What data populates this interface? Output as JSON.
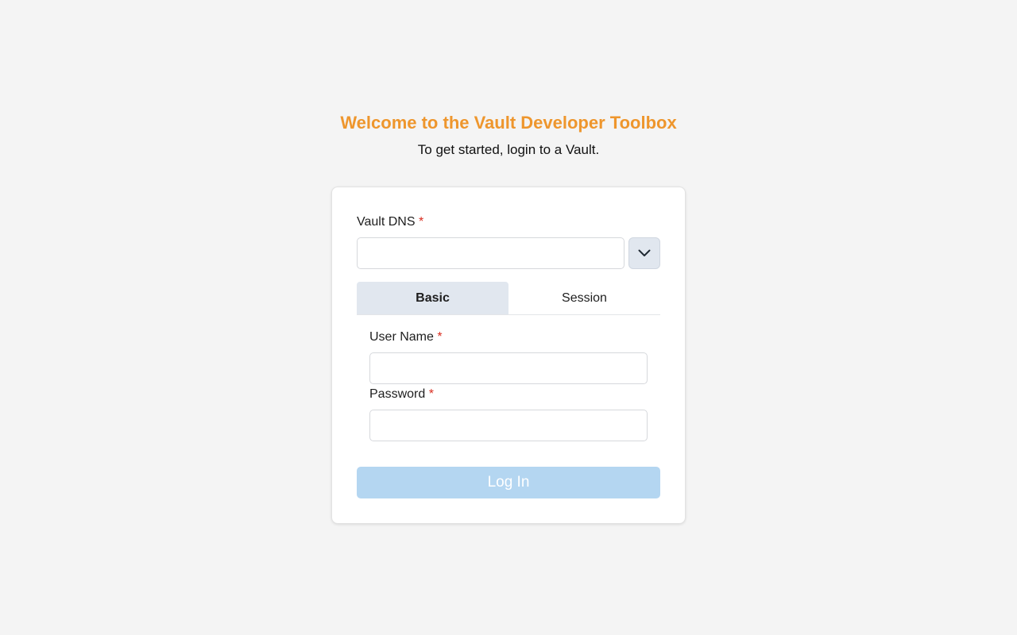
{
  "header": {
    "title": "Welcome to the Vault Developer Toolbox",
    "subtitle": "To get started, login to a Vault."
  },
  "form": {
    "vault_dns": {
      "label": "Vault DNS",
      "required_mark": "*",
      "value": "",
      "placeholder": ""
    },
    "dropdown_icon": "chevron-down-icon",
    "tabs": [
      {
        "label": "Basic",
        "active": true
      },
      {
        "label": "Session",
        "active": false
      }
    ],
    "username": {
      "label": "User Name",
      "required_mark": "*",
      "value": "",
      "placeholder": ""
    },
    "password": {
      "label": "Password",
      "required_mark": "*",
      "value": "",
      "placeholder": ""
    },
    "login_button": {
      "label": "Log In",
      "disabled": true
    }
  },
  "colors": {
    "accent": "#ee962d",
    "required": "#d92d20",
    "button_disabled": "#b4d6f1",
    "tab_active_bg": "#e1e7ef",
    "background": "#f4f4f4"
  }
}
